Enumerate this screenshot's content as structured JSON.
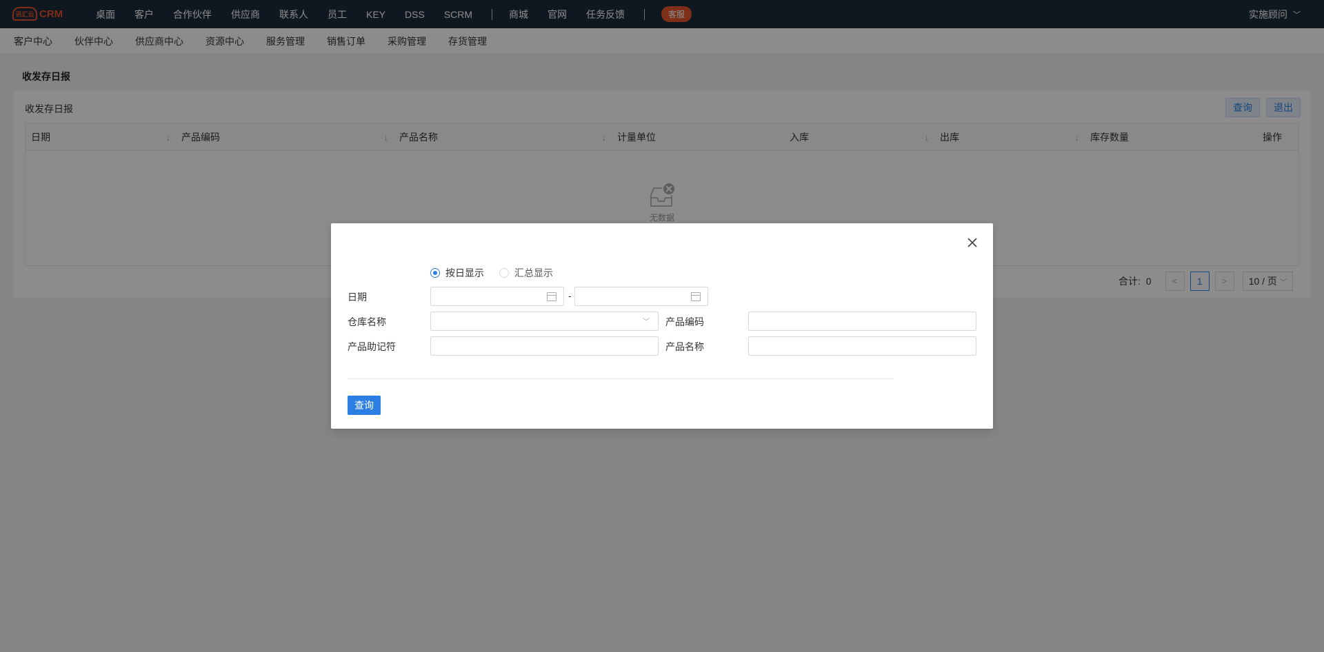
{
  "topbar": {
    "logo_badge": "讯汇云",
    "logo_text": "CRM",
    "nav": [
      "桌面",
      "客户",
      "合作伙伴",
      "供应商",
      "联系人",
      "员工",
      "KEY",
      "DSS",
      "SCRM"
    ],
    "nav2": [
      "商城",
      "官网",
      "任务反馈"
    ],
    "kefu": "客服",
    "user": "实施顾问"
  },
  "subnav": [
    "客户中心",
    "伙伴中心",
    "供应商中心",
    "资源中心",
    "服务管理",
    "销售订单",
    "采购管理",
    "存货管理"
  ],
  "page": {
    "title": "收发存日报",
    "panel_title": "收发存日报",
    "btn_query": "查询",
    "btn_exit": "退出",
    "columns": [
      "日期",
      "产品编码",
      "产品名称",
      "计量单位",
      "入库",
      "出库",
      "库存数量",
      "操作"
    ],
    "empty_text": "无数据",
    "pager": {
      "total_label": "合计:",
      "total": "0",
      "page": "1",
      "page_size": "10 / 页"
    }
  },
  "modal": {
    "radio_daily": "按日显示",
    "radio_summary": "汇总显示",
    "label_date": "日期",
    "date_sep": "-",
    "label_warehouse": "仓库名称",
    "label_code": "产品编码",
    "label_mnemonic": "产品助记符",
    "label_name": "产品名称",
    "btn_query": "查询"
  },
  "colors": {
    "topbar": "#1c2b3c",
    "accent": "#2b7fe3",
    "brand": "#e8562a"
  }
}
